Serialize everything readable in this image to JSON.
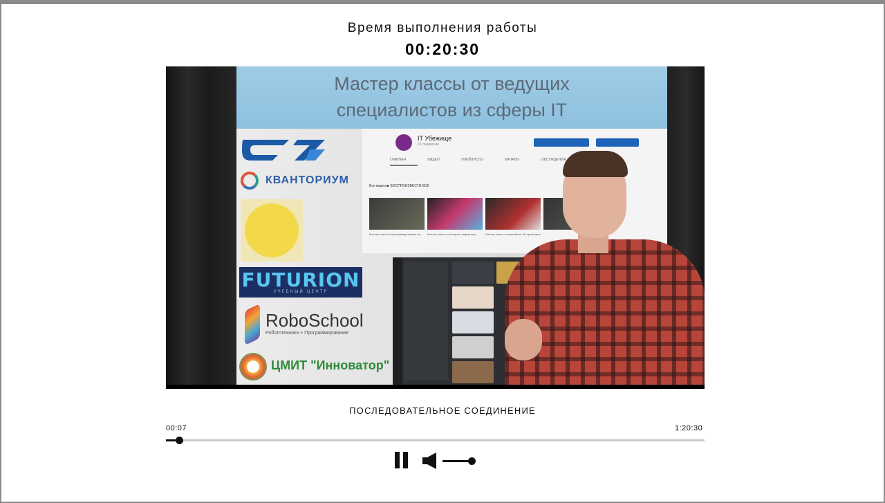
{
  "header": {
    "timer_label": "Время выполнения работы",
    "timer_value": "00:20:30"
  },
  "video": {
    "board_title_line1": "Мастер классы от ведущих",
    "board_title_line2": "специалистов из сферы IT",
    "logos": {
      "sgtu": "СГТУ",
      "kvantorium": "КВАНТОРИУМ",
      "futurion": "FUTURION",
      "futurion_sub": "УЧЕБНЫЙ ЦЕНТР",
      "roboschool": "RoboSchool",
      "roboschool_sub": "Робототехника + Программирование",
      "cmit": "ЦМИТ \"Инноватор\""
    },
    "youtube": {
      "channel_name": "IT Убежище",
      "channel_subscribers": "91 подписчик",
      "tabs": "ГЛАВНАЯ ВИДЕО ПЛЕЙЛИСТЫ КАНАЛЫ ОБСУЖДЕНИЯ",
      "section": "Все видео ▶ ВОСПРОИЗВЕСТИ ВСЕ",
      "captions": [
        "Мастер класс по программированию на...",
        "Мастер класс по интернет маркетингу",
        "Мастер класс по разработке 3D принтеров",
        ""
      ]
    }
  },
  "player": {
    "track_title": "ПОСЛЕДОВАТЕЛЬНОЕ СОЕДИНЕНИЕ",
    "current_time": "00:07",
    "total_time": "1:20:30",
    "progress_fraction": 0.024,
    "volume_fraction": 1.0,
    "icons": {
      "pause": "pause-icon",
      "volume": "speaker-icon"
    },
    "colors": {
      "controls": "#111111",
      "rail": "#c8c8c8"
    }
  }
}
